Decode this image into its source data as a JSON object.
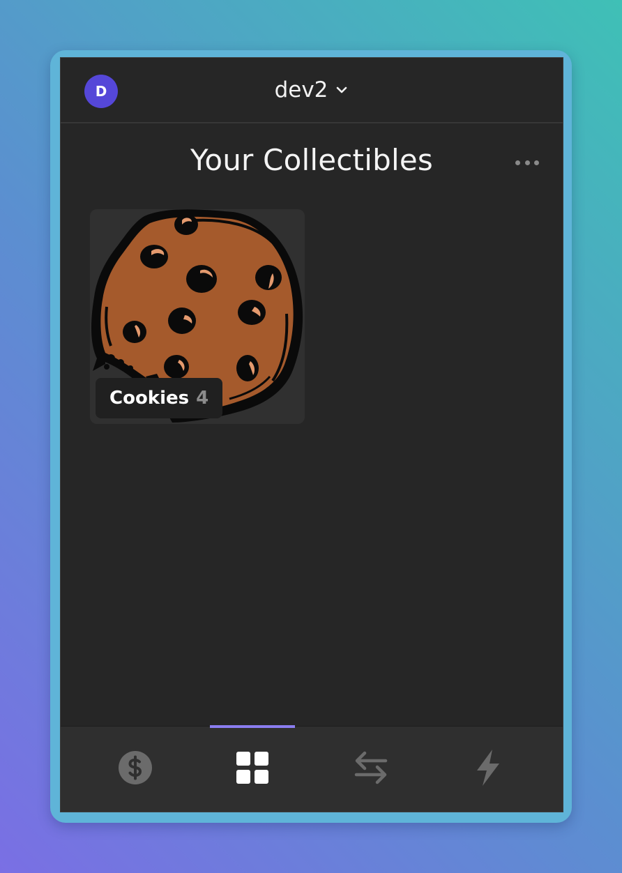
{
  "header": {
    "avatar_initial": "D",
    "account_name": "dev2",
    "account_icon": "chevron-down-icon"
  },
  "main": {
    "title": "Your Collectibles",
    "menu_icon": "more-horizontal-icon",
    "collectibles": [
      {
        "name": "Cookies",
        "count": "4",
        "image": "cookie-image"
      }
    ]
  },
  "tabbar": {
    "active_tab": "collectibles",
    "accent": "#8b7df0",
    "tabs": [
      {
        "id": "balances",
        "icon": "dollar-circle-icon"
      },
      {
        "id": "collectibles",
        "icon": "grid-icon"
      },
      {
        "id": "swap",
        "icon": "swap-arrows-icon"
      },
      {
        "id": "activity",
        "icon": "lightning-icon"
      }
    ]
  },
  "colors": {
    "background": "#262626",
    "avatar": "#5547d8",
    "card": "#303030"
  }
}
